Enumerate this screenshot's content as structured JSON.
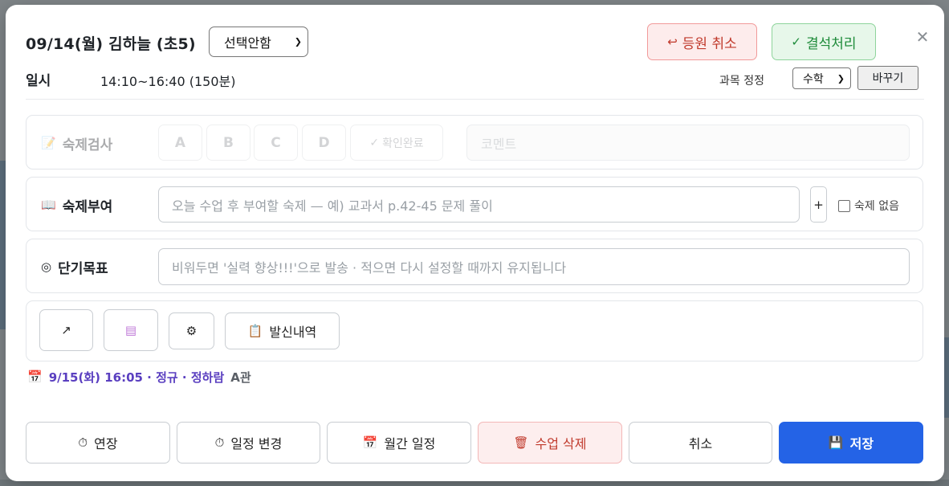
{
  "header": {
    "title": "09/14(월) 김하늘 (초5)",
    "status_select": "선택안함",
    "cancel_attendance": "등원 취소",
    "absence": "결석처리"
  },
  "schedule": {
    "label": "일시",
    "value": "14:10~16:40 (150분)",
    "subject_label": "과목 정정",
    "subject_select": "수학",
    "change_button": "바꾸기"
  },
  "homework_check": {
    "label": "숙제검사",
    "grades": [
      "A",
      "B",
      "C",
      "D"
    ],
    "confirm": "확인완료",
    "comment_placeholder": "코멘트"
  },
  "homework_assign": {
    "label": "숙제부여",
    "placeholder": "오늘 수업 후 부여할 숙제 — 예) 교과서 p.42-45 문제 풀이",
    "plus": "+",
    "no_homework": "숙제 없음"
  },
  "goal": {
    "label": "단기목표",
    "placeholder": "비워두면 '실력 향상!!!'으로 발송 · 적으면 다시 설정할 때까지 유지됩니다"
  },
  "actions": {
    "history": "발신내역"
  },
  "next_session": {
    "text": "9/15(화) 16:05 · 정규 · 정하람",
    "branch": "A관"
  },
  "footer": {
    "extend": "연장",
    "reschedule": "일정 변경",
    "monthly": "월간 일정",
    "delete": "수업 삭제",
    "cancel": "취소",
    "save": "저장"
  },
  "colors": {
    "primary": "#2463e6",
    "danger": "#c0392b",
    "success": "#1e8b3a",
    "accent_text": "#5a3fc0"
  },
  "icons": {
    "cancel_attendance": "return-arrow-icon",
    "absence": "check-icon",
    "close": "close-icon",
    "homework_check": "memo-icon",
    "homework_assign": "book-icon",
    "goal": "target-icon",
    "action_1": "arrow-up-right-icon",
    "action_2": "card-icon",
    "action_3": "gear-icon",
    "history": "clipboard-icon",
    "calendar": "calendar-icon",
    "extend": "stopwatch-icon",
    "delete": "trash-icon",
    "save": "floppy-icon"
  }
}
